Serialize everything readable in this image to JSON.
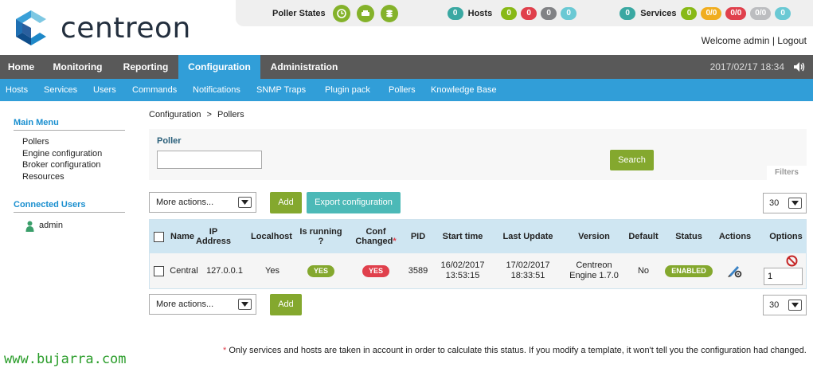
{
  "brand": {
    "name": "centreon"
  },
  "status_bar": {
    "poller_states_label": "Poller States",
    "poller_icons": [
      "clock-icon",
      "database-drive-icon",
      "stack-icon"
    ],
    "hosts_label": "Hosts",
    "hosts": {
      "total": "0",
      "up": "0",
      "down": "0",
      "unreachable": "0",
      "pending": "0"
    },
    "services_label": "Services",
    "services": {
      "total": "0",
      "ok": "0",
      "warning": "0/0",
      "critical": "0/0",
      "unknown": "0/0",
      "pending": "0"
    }
  },
  "welcome": {
    "text": "Welcome admin",
    "separator": "|",
    "logout": "Logout"
  },
  "main_nav": [
    {
      "label": "Home"
    },
    {
      "label": "Monitoring"
    },
    {
      "label": "Reporting"
    },
    {
      "label": "Configuration",
      "active": true
    },
    {
      "label": "Administration"
    }
  ],
  "datetime": "2017/02/17 18:34",
  "sub_nav": [
    "Hosts",
    "Services",
    "Users",
    "Commands",
    "Notifications",
    "SNMP Traps",
    "Plugin pack",
    "Pollers",
    "Knowledge Base"
  ],
  "sidebar": {
    "main_menu_title": "Main Menu",
    "items": [
      "Pollers",
      "Engine configuration",
      "Broker configuration",
      "Resources"
    ],
    "connected_users_title": "Connected Users",
    "users": [
      "admin"
    ]
  },
  "breadcrumb": {
    "parent": "Configuration",
    "sep": ">",
    "current": "Pollers"
  },
  "filter": {
    "label": "Poller",
    "value": "",
    "search_label": "Search",
    "filters_tab": "Filters"
  },
  "actions": {
    "more_actions": "More actions...",
    "add_label": "Add",
    "export_label": "Export configuration",
    "page_size": "30"
  },
  "table": {
    "headers": {
      "name": "Name",
      "ip": "IP Address",
      "localhost": "Localhost",
      "running": "Is running ?",
      "conf_changed": "Conf Changed",
      "conf_star": "*",
      "pid": "PID",
      "start_time": "Start time",
      "last_update": "Last Update",
      "version": "Version",
      "default": "Default",
      "status": "Status",
      "actions": "Actions",
      "options": "Options"
    },
    "rows": [
      {
        "name": "Central",
        "ip": "127.0.0.1",
        "localhost": "Yes",
        "running": "YES",
        "conf_changed": "YES",
        "pid": "3589",
        "start_time": "16/02/2017 13:53:15",
        "last_update": "17/02/2017 18:33:51",
        "version": "Centreon Engine 1.7.0",
        "default": "No",
        "status": "ENABLED",
        "option_value": "1"
      }
    ]
  },
  "footnote": {
    "star": "*",
    "text": "Only services and hosts are taken in account in order to calculate this status. If you modify a template, it won't tell you the configuration had changed."
  },
  "watermark": "www.bujarra.com",
  "colors": {
    "nav_bg": "#595959",
    "accent_blue": "#319ed8",
    "green": "#84a82e",
    "teal": "#4cb9b7",
    "red": "#e0404c"
  }
}
